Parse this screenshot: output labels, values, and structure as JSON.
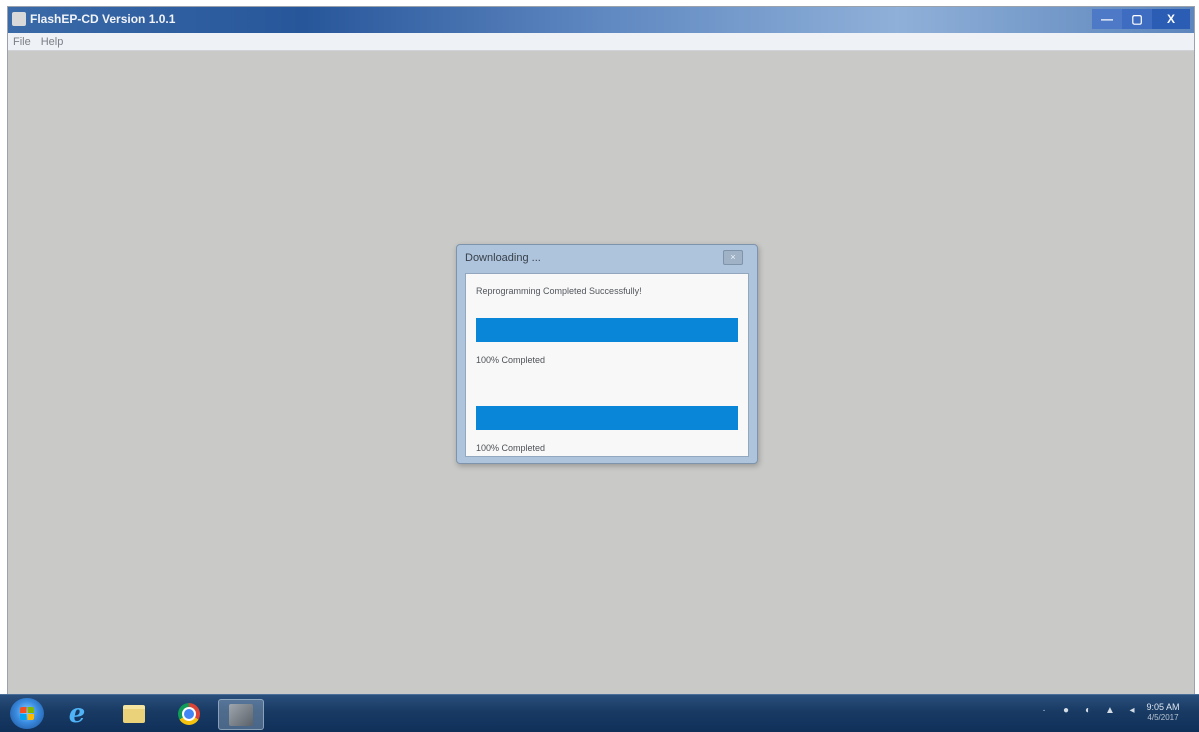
{
  "window": {
    "title": "FlashEP-CD Version 1.0.1",
    "minimize_glyph": "—",
    "maximize_glyph": "▢",
    "close_glyph": "X"
  },
  "menu": {
    "items": [
      {
        "label": "File"
      },
      {
        "label": "Help"
      }
    ]
  },
  "dialog": {
    "title": "Downloading ...",
    "close_glyph": "×",
    "message": "Reprogramming Completed Successfully!",
    "progress": [
      {
        "percent": 100,
        "label": "100% Completed"
      },
      {
        "percent": 100,
        "label": "100% Completed"
      }
    ]
  },
  "taskbar": {
    "icons": [
      "start-button",
      "internet-explorer-icon",
      "file-explorer-icon",
      "chrome-icon",
      "flash-app-icon"
    ],
    "ie_glyph": "e",
    "tray": {
      "chevron": "·",
      "icons": [
        "●",
        "◐",
        "▲",
        "◂"
      ]
    },
    "clock": {
      "time": "9:05 AM",
      "date": "4/5/2017"
    }
  },
  "colors": {
    "progress_fill": "#0a86d8",
    "workspace": "#c9cac7"
  }
}
